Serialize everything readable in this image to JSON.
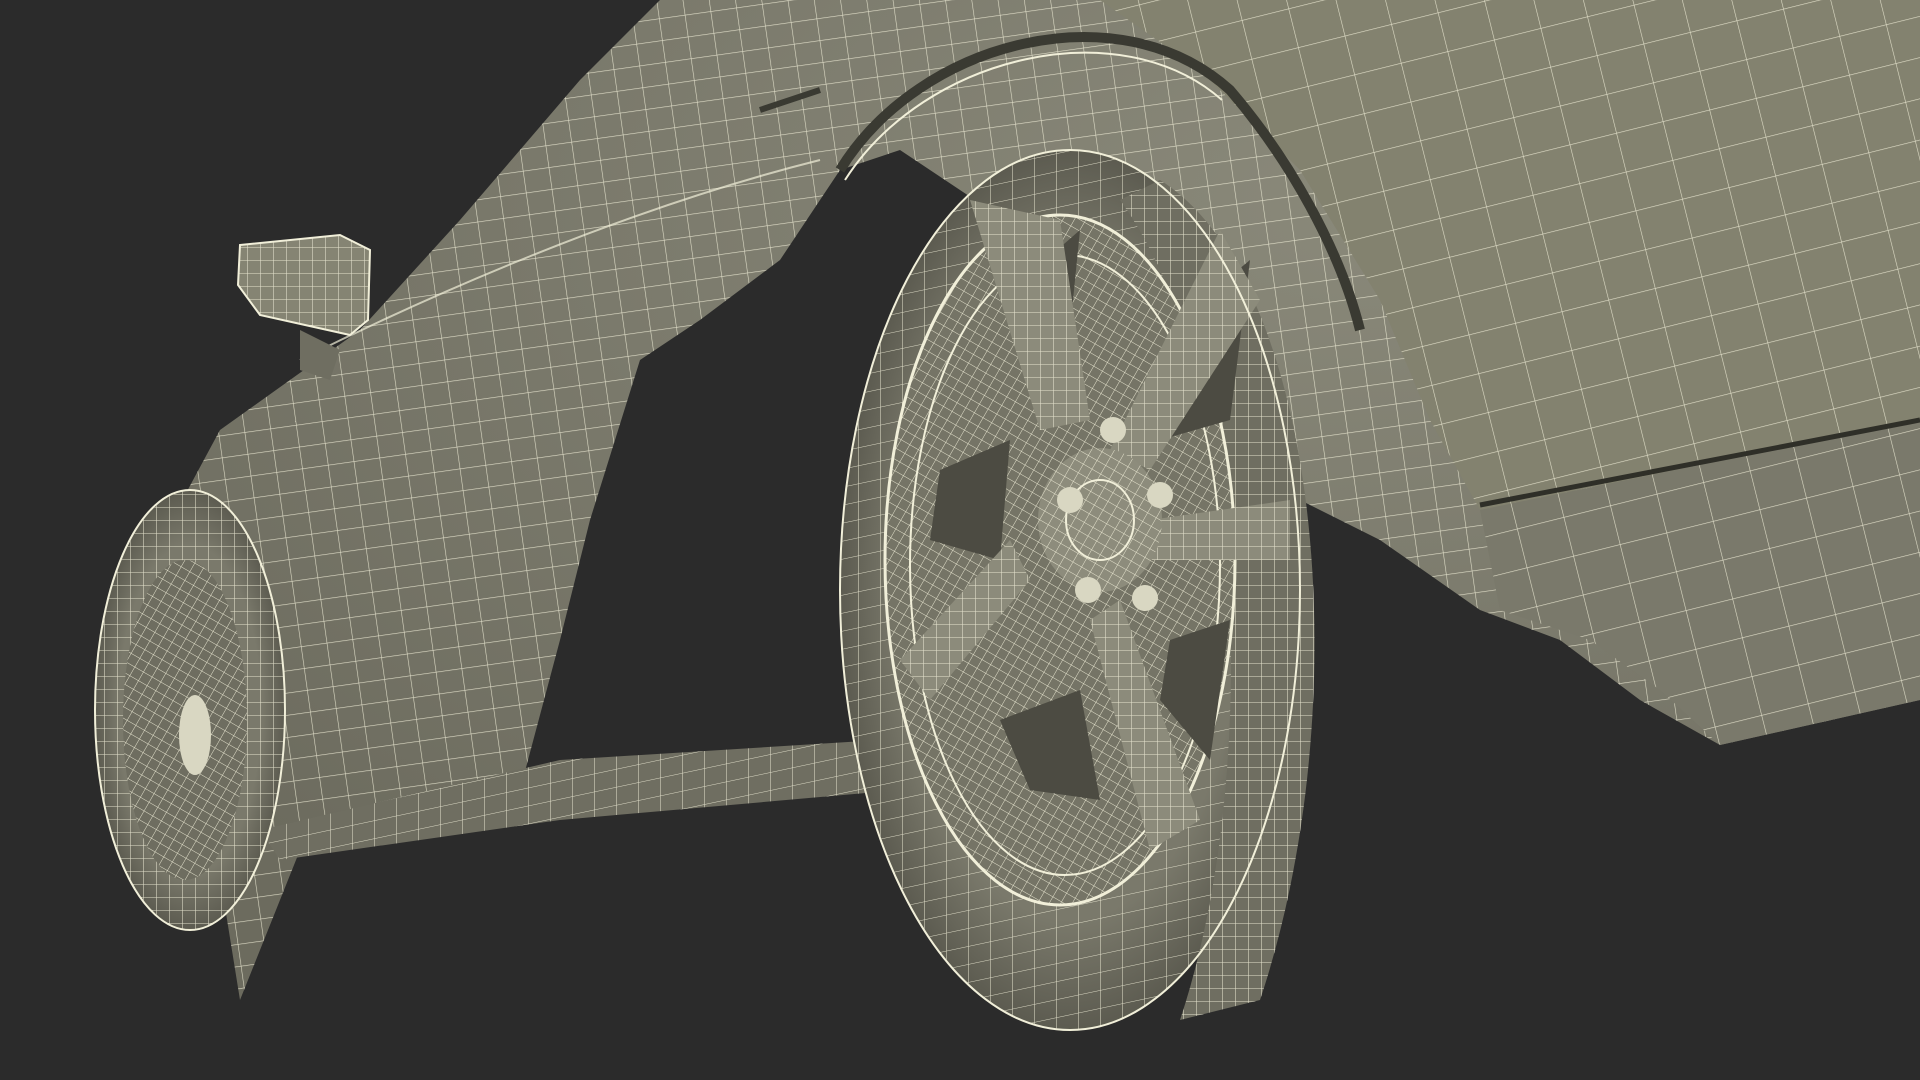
{
  "viewport": {
    "background_color": "#2b2b2b",
    "model_fill_color": "#7e7d6e",
    "model_shadow_color": "#5f5e52",
    "model_dark_color": "#4a4a40",
    "wire_color": "#f1efd9"
  },
  "scene": {
    "subject": "car-wireframe-model",
    "visible_parts": [
      "body",
      "side-mirror",
      "front-wheel",
      "rear-wheel",
      "side-skirt"
    ]
  }
}
